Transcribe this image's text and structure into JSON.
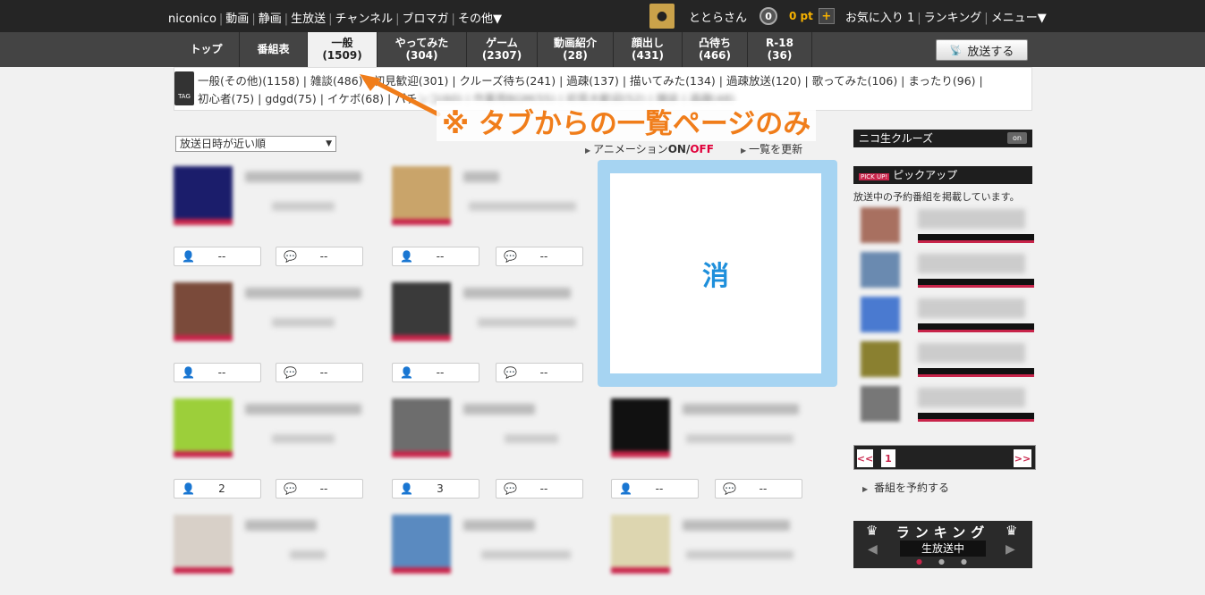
{
  "header": {
    "site_links": [
      "niconico",
      "動画",
      "静画",
      "生放送",
      "チャンネル",
      "ブロマガ",
      "その他▼"
    ],
    "username": "ととらさん",
    "notification_count": "0",
    "points": "0 pt",
    "plus_label": "+",
    "right_links": [
      "お気に入り 1",
      "ランキング",
      "メニュー▼"
    ]
  },
  "tabs": [
    {
      "name": "トップ",
      "count": ""
    },
    {
      "name": "番組表",
      "count": ""
    },
    {
      "name": "一般",
      "count": "(1509)"
    },
    {
      "name": "やってみた",
      "count": "(304)"
    },
    {
      "name": "ゲーム",
      "count": "(2307)"
    },
    {
      "name": "動画紹介",
      "count": "(28)"
    },
    {
      "name": "顔出し",
      "count": "(431)"
    },
    {
      "name": "凸待ち",
      "count": "(466)"
    },
    {
      "name": "R-18",
      "count": "(36)"
    }
  ],
  "broadcast_button": "放送する",
  "tag_box": {
    "icon_label": "TAG",
    "line1": "一般(その他)(1158) | 雑談(486) | 初見歓迎(301) | クルーズ待ち(241) | 過疎(137) | 描いてみた(134) | 過疎放送(120) | 歌ってみた(106) | まったり(96) |",
    "line2_visible": "初心者(75) | gdgd(75) | イケボ(68) | パチ",
    "line2_blurred": "ンコ(60) | 作業用BGM(55) | 初見大歓迎(52) | 雑談 | 過疎(48)"
  },
  "annotation": "※ タブからの一覧ページのみ",
  "sort_select": {
    "value": "放送日時が近い順",
    "caret": "▼"
  },
  "animation_toggle": {
    "label": "アニメーション",
    "on": "ON",
    "slash": "/",
    "off": "OFF"
  },
  "refresh_link": "一覧を更新",
  "program_stats": [
    [
      "--",
      "--"
    ],
    [
      "--",
      "--"
    ],
    [
      "--",
      "--"
    ],
    [
      "--",
      "--"
    ],
    [
      "2",
      "--"
    ],
    [
      "3",
      "--"
    ],
    [
      "--",
      "--"
    ],
    [
      "",
      ""
    ],
    [
      "",
      ""
    ],
    [
      "",
      ""
    ]
  ],
  "ad_char": "消",
  "cruise": {
    "label": "ニコ生クルーズ",
    "toggle": "on"
  },
  "pickup": {
    "title": "ピックアップ",
    "description": "放送中の予約番組を掲載しています。"
  },
  "pager": {
    "prev": "<<",
    "page": "1",
    "next": ">>"
  },
  "reserve_link": "番組を予約する",
  "ranking": {
    "title": "ランキング",
    "live_label": "生放送中",
    "left": "◀",
    "right": "▶"
  },
  "colors": {
    "accent_orange": "#f07d1a",
    "brand_red": "#c8244a",
    "ad_blue": "#1e8fdb"
  }
}
